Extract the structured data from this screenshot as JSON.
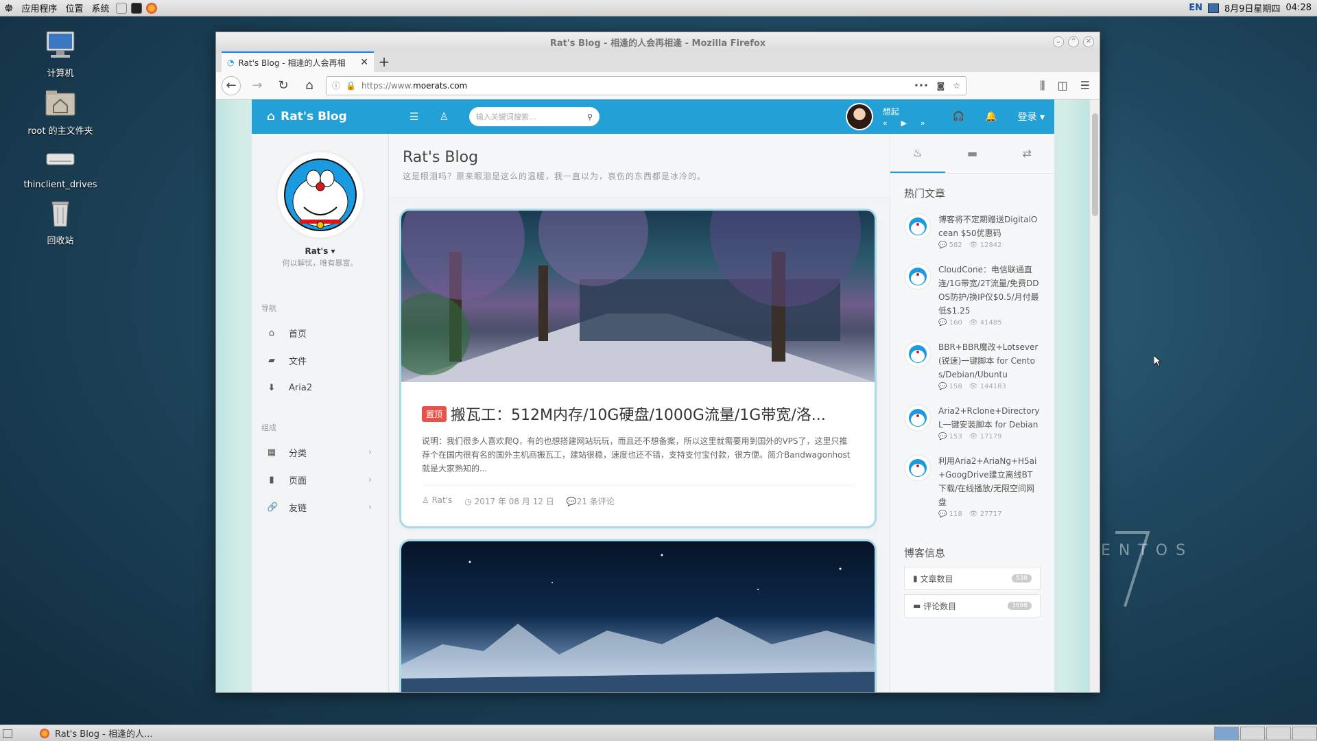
{
  "top_panel": {
    "menu_apps": "应用程序",
    "menu_places": "位置",
    "menu_system": "系统",
    "lang": "EN",
    "date": "8月9日星期四",
    "time": "04:28"
  },
  "desktop": {
    "icons": [
      {
        "label": "计算机"
      },
      {
        "label": "root 的主文件夹"
      },
      {
        "label": "thinclient_drives"
      },
      {
        "label": "回收站"
      }
    ],
    "brand_text": "ENTOS"
  },
  "window": {
    "title": "Rat's Blog - 相逢的人会再相逢 - Mozilla Firefox",
    "tab_title": "Rat's Blog - 相逢的人会再相",
    "url_prefix": "https://www.",
    "url_host": "moerats.com"
  },
  "site": {
    "brand": "Rat's Blog",
    "search_placeholder": "输入关键词搜索...",
    "player_name": "想起",
    "login": "登录",
    "user_name": "Rat's",
    "user_motto": "何以解忧，唯有暴富。",
    "nav_section": "导航",
    "nav": [
      "首页",
      "文件",
      "Aria2"
    ],
    "compose_section": "组成",
    "compose": [
      "分类",
      "页面",
      "友链"
    ],
    "page_title": "Rat's Blog",
    "page_subtitle": "这是眼泪吗？原来眼泪是这么的温暖，我一直以为，哀伤的东西都是冰冷的。",
    "post": {
      "badge": "置顶",
      "title": "搬瓦工：512M内存/10G硬盘/1000G流量/1G带宽/洛...",
      "excerpt": "说明：我们很多人喜欢爬Q，有的也想搭建网站玩玩，而且还不想备案，所以这里就需要用到国外的VPS了，这里只推荐个在国内很有名的国外主机商搬瓦工，建站很稳，速度也还不错，支持支付宝付款，很方便。简介Bandwagonhost就是大家熟知的...",
      "author": "Rat's",
      "date": "2017 年 08 月 12 日",
      "comments": "21 条评论"
    },
    "hot_title": "热门文章",
    "hot": [
      {
        "title": "博客将不定期赠送DigitalOcean $50优惠码",
        "comments": "582",
        "views": "12842"
      },
      {
        "title": "CloudCone：电信联通直连/1G带宽/2T流量/免费DDOS防护/换IP仅$0.5/月付最低$1.25",
        "comments": "160",
        "views": "41485"
      },
      {
        "title": "BBR+BBR魔改+Lotsever(锐速)一键脚本 for Centos/Debian/Ubuntu",
        "comments": "158",
        "views": "144183"
      },
      {
        "title": "Aria2+Rclone+DirectoryL一键安装脚本 for Debian",
        "comments": "153",
        "views": "17179"
      },
      {
        "title": "利用Aria2+AriaNg+H5ai+GoogDrive建立离线BT下载/在线播放/无限空间网盘",
        "comments": "118",
        "views": "27717"
      }
    ],
    "info_title": "博客信息",
    "info": [
      {
        "label": "文章数目",
        "count": "538"
      },
      {
        "label": "评论数目",
        "count": "3698"
      }
    ]
  },
  "taskbar": {
    "task_label": "Rat's Blog - 相逢的人..."
  },
  "colors": {
    "accent": "#23a1d6",
    "badge": "#e8524a"
  }
}
